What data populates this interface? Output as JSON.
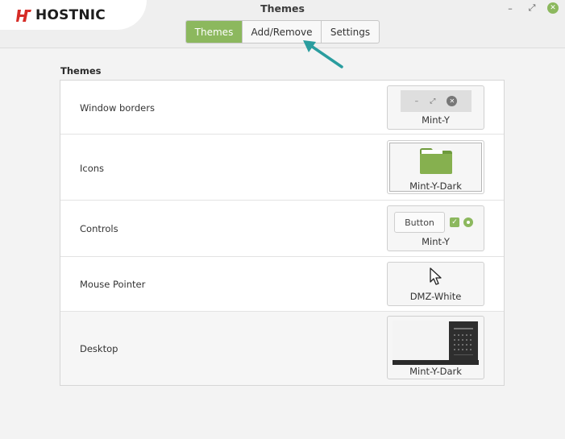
{
  "logo": {
    "text_main": "H",
    "text_accent": "",
    "text_rest": "OSTNIC"
  },
  "window": {
    "title": "Themes",
    "minimize_glyph": "–",
    "maximize_glyph": "⤢",
    "close_glyph": "✕"
  },
  "tabs": [
    {
      "label": "Themes",
      "active": true
    },
    {
      "label": "Add/Remove",
      "active": false
    },
    {
      "label": "Settings",
      "active": false
    }
  ],
  "section": {
    "title": "Themes"
  },
  "rows": [
    {
      "label": "Window borders",
      "value": "Mint-Y"
    },
    {
      "label": "Icons",
      "value": "Mint-Y-Dark"
    },
    {
      "label": "Controls",
      "value": "Mint-Y",
      "button_preview": "Button"
    },
    {
      "label": "Mouse Pointer",
      "value": "DMZ-White"
    },
    {
      "label": "Desktop",
      "value": "Mint-Y-Dark"
    }
  ],
  "colors": {
    "accent": "#8cb85e",
    "logo_red": "#d62c27",
    "arrow": "#2a9d9f",
    "folder": "#86b04f"
  },
  "icons": {
    "window_borders": [
      "minimize-icon",
      "maximize-icon",
      "close-icon"
    ],
    "icons_preview": "folder-icon",
    "mouse_pointer": "arrow-cursor-icon"
  }
}
